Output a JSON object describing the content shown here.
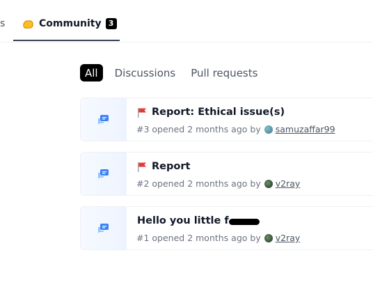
{
  "tabs": {
    "prev_fragment": "s",
    "community_label": "Community",
    "community_count": "3"
  },
  "filters": [
    {
      "label": "All",
      "active": true
    },
    {
      "label": "Discussions",
      "active": false
    },
    {
      "label": "Pull requests",
      "active": false
    }
  ],
  "discussions": [
    {
      "title": "Report: Ethical issue(s)",
      "has_flag": true,
      "meta_prefix": "#3 opened 2 months ago by",
      "user": "samuzaffar99",
      "avatar_color": "#5aa9a0"
    },
    {
      "title": "Report",
      "has_flag": true,
      "meta_prefix": "#2 opened 2 months ago by",
      "user": "v2ray",
      "avatar_color": "#2f4f2f"
    },
    {
      "title": "Hello you little f",
      "has_flag": false,
      "redacted": true,
      "meta_prefix": "#1 opened 2 months ago by",
      "user": "v2ray",
      "avatar_color": "#2f4f2f"
    }
  ],
  "colors": {
    "flag": "#e53935",
    "discussion_icon": "#3b82f6",
    "community_icon": "#fbbf24"
  }
}
